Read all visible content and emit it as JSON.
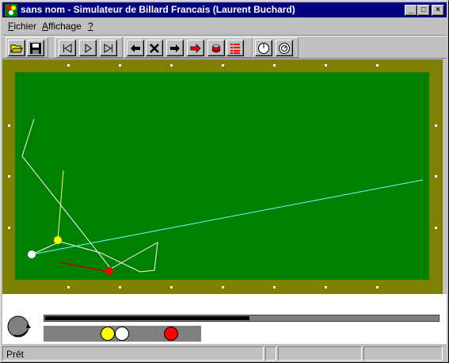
{
  "window": {
    "title": "sans nom - Simulateur de Billard Francais (Laurent Buchard)",
    "controls": {
      "minimize": "_",
      "maximize": "□",
      "close": "×"
    }
  },
  "menu": [
    {
      "label": "Fichier",
      "accel": "F",
      "rest": "ichier"
    },
    {
      "label": "Affichage",
      "accel": "A",
      "rest": "ffichage"
    },
    {
      "label": "?",
      "accel": "?",
      "rest": ""
    }
  ],
  "toolbar": {
    "icons": [
      "open-folder-icon",
      "save-disk-icon",
      "rewind-icon",
      "play-icon",
      "fast-forward-icon",
      "arrow-left-icon",
      "cancel-x-icon",
      "arrow-right-icon",
      "red-arrow-right-icon",
      "stack-icon",
      "list-icon",
      "cue-ball-aim-icon",
      "cue-ball-spin-icon"
    ]
  },
  "table": {
    "colors": {
      "cushion": "#808000",
      "cloth": "#008000",
      "diamond": "#ffffff"
    },
    "balls": [
      {
        "name": "yellow-ball",
        "color": "#ffff00"
      },
      {
        "name": "white-ball",
        "color": "#ffffff"
      },
      {
        "name": "red-ball",
        "color": "#ff0000"
      }
    ],
    "trajectory_colors": {
      "white": "#ffffff",
      "yellow": "#ffff66",
      "cue": "#66ffff",
      "red": "#c00000"
    }
  },
  "panel": {
    "power_level": 0.52,
    "tray_balls": [
      {
        "name": "yellow",
        "color": "#ffff00"
      },
      {
        "name": "white",
        "color": "#ffffff"
      },
      {
        "name": "red",
        "color": "#ff0000"
      }
    ]
  },
  "status": {
    "text": "Prêt"
  }
}
